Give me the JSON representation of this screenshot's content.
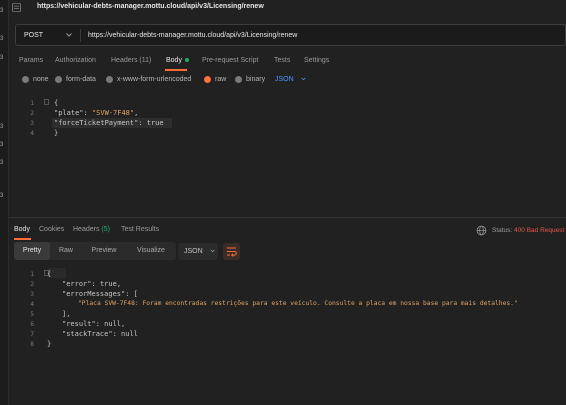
{
  "window": {
    "title": "https://vehicular-debts-manager.mottu.cloud/api/v3/Licensing/renew"
  },
  "gutter_numbers": [
    "3",
    "3",
    "3",
    "3",
    "3",
    "3",
    "3"
  ],
  "request": {
    "method": "POST",
    "url": "https://vehicular-debts-manager.mottu.cloud/api/v3/Licensing/renew",
    "tabs": [
      {
        "label": "Params"
      },
      {
        "label": "Authorization"
      },
      {
        "label": "Headers (11)"
      },
      {
        "label": "Body"
      },
      {
        "label": "Pre-request Script"
      },
      {
        "label": "Tests"
      },
      {
        "label": "Settings"
      }
    ],
    "active_tab": "Body",
    "body_types": [
      {
        "label": "none"
      },
      {
        "label": "form-data"
      },
      {
        "label": "x-www-form-urlencoded"
      },
      {
        "label": "raw"
      },
      {
        "label": "binary"
      }
    ],
    "selected_body_type": "raw",
    "format": "JSON",
    "code_lines": [
      "1",
      "2",
      "3",
      "4"
    ],
    "code": {
      "open": "{",
      "plate_key": "\"plate\"",
      "plate_val": "\"SVW-7F48\"",
      "ftp_key": "\"forceTicketPayment\"",
      "ftp_val": "true",
      "close": "}"
    }
  },
  "response": {
    "tabs": [
      {
        "label": "Body"
      },
      {
        "label": "Cookies"
      },
      {
        "label": "Headers"
      },
      {
        "label": "(5)"
      },
      {
        "label": "Test Results"
      }
    ],
    "status_label": "Status:",
    "status_value": "400 Bad Request",
    "view_modes": [
      "Pretty",
      "Raw",
      "Preview",
      "Visualize"
    ],
    "active_view": "Pretty",
    "format": "JSON",
    "code_lines": [
      "1",
      "2",
      "3",
      "4",
      "5",
      "6",
      "7",
      "8"
    ],
    "code": {
      "open": "{",
      "error_key": "\"error\"",
      "error_val": "true",
      "msgs_key": "\"errorMessages\"",
      "msg_val": "\"Placa SVW-7F48: Foram encontradas restrições para este veículo. Consulte a placa em nossa base para mais detalhes.\"",
      "arr_close": "],",
      "result_key": "\"result\"",
      "result_val": "null",
      "stack_key": "\"stackTrace\"",
      "stack_val": "null",
      "close": "}"
    }
  },
  "colors": {
    "accent": "#ff6c37",
    "error": "#e5574a",
    "link": "#4f95ff",
    "string": "#e2a468"
  }
}
